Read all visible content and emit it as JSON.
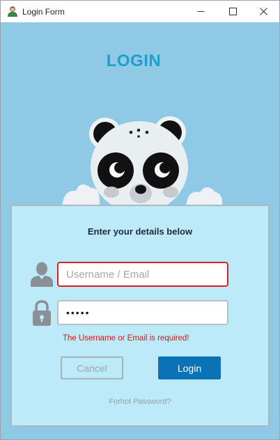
{
  "window": {
    "title": "Login Form",
    "icons": {
      "app": "user-icon",
      "minimize": "minimize-icon",
      "maximize": "maximize-icon",
      "close": "close-icon"
    }
  },
  "header": {
    "title": "LOGIN"
  },
  "form": {
    "heading": "Enter your details below",
    "username": {
      "value": "",
      "placeholder": "Username / Email",
      "icon": "user-icon"
    },
    "password": {
      "value": "•••••",
      "icon": "lock-icon"
    },
    "error": "The Username or Email is required!",
    "cancel_label": "Cancel",
    "login_label": "Login",
    "forgot_label": "Forhot Password?"
  },
  "colors": {
    "background": "#8ec9e6",
    "card": "#bdeaf8",
    "accent": "#1f9fcf",
    "login_button": "#0a72b5",
    "error": "#d01818"
  }
}
